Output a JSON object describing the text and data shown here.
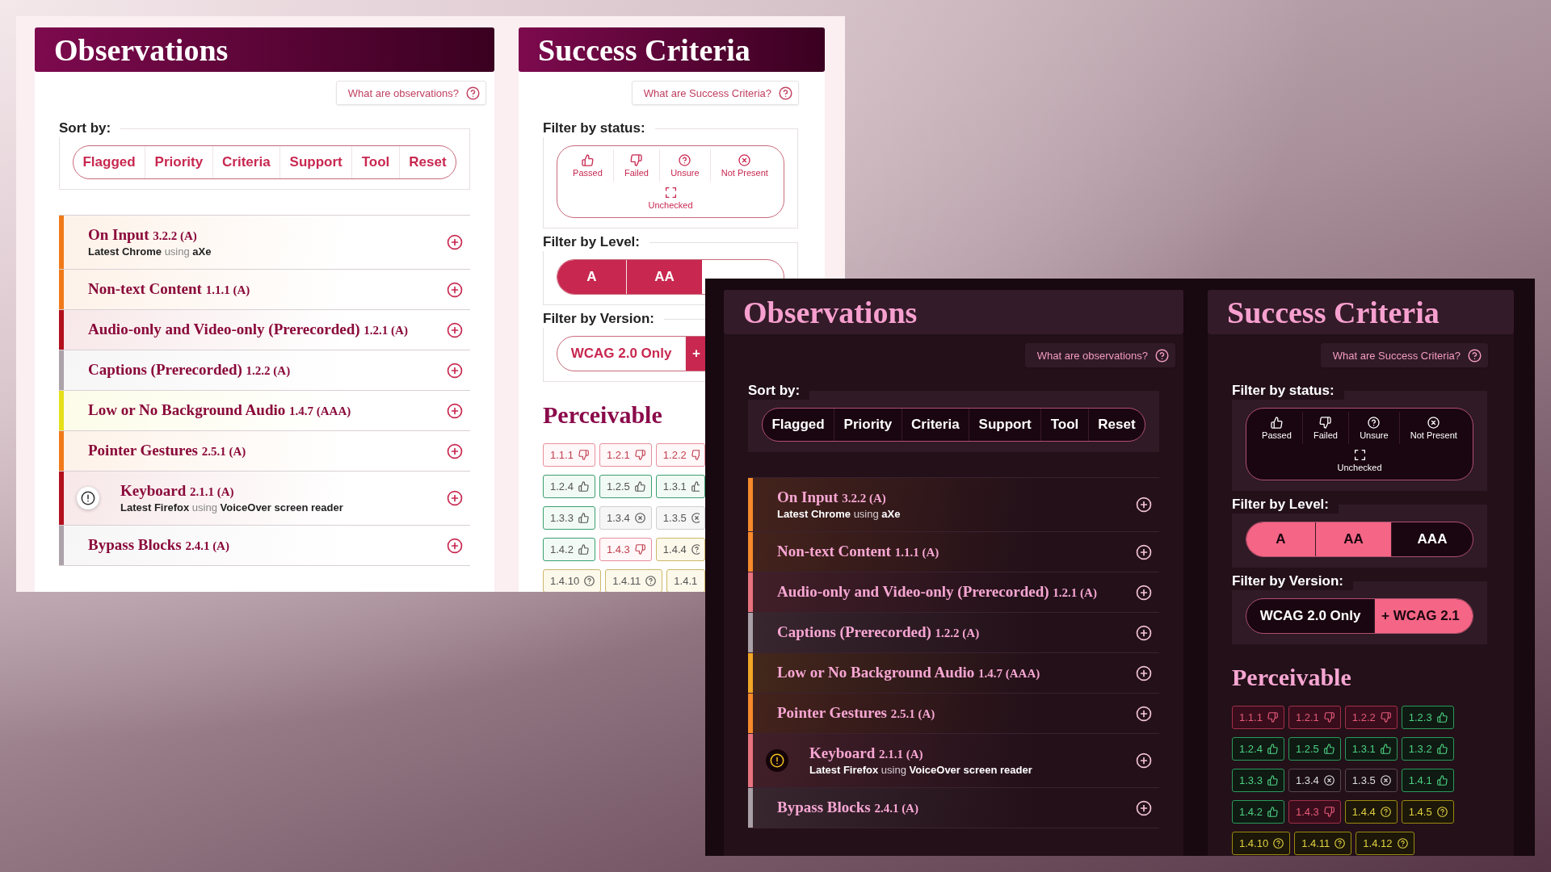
{
  "windows": [
    {
      "kind": "light",
      "observations": {
        "title": "Observations",
        "help": "What are observations?",
        "sort_label": "Sort by:",
        "sort_buttons": [
          "Flagged",
          "Priority",
          "Criteria",
          "Support",
          "Tool",
          "Reset"
        ],
        "items": [
          {
            "title": "On Input",
            "code": "3.2.2 (A)",
            "detail": "**Latest Chrome** using **aXe**",
            "color": "#f07a1a",
            "flagged": false
          },
          {
            "title": "Non-text Content",
            "code": "1.1.1 (A)",
            "color": "#f07a1a",
            "flagged": false
          },
          {
            "title": "Audio-only and Video-only (Prerecorded)",
            "code": "1.2.1 (A)",
            "color": "#b3101e",
            "flagged": false
          },
          {
            "title": "Captions (Prerecorded)",
            "code": "1.2.2 (A)",
            "color": "#aca2aa",
            "flagged": false
          },
          {
            "title": "Low or No Background Audio",
            "code": "1.4.7 (AAA)",
            "color": "#e5e01a",
            "flagged": false
          },
          {
            "title": "Pointer Gestures",
            "code": "2.5.1 (A)",
            "color": "#f07a1a",
            "flagged": false
          },
          {
            "title": "Keyboard",
            "code": "2.1.1 (A)",
            "detail": "**Latest Firefox** using **VoiceOver screen reader**",
            "color": "#b3101e",
            "flagged": true
          },
          {
            "title": "Bypass Blocks",
            "code": "2.4.1 (A)",
            "color": "#aca2aa",
            "flagged": false
          }
        ]
      },
      "criteria": {
        "title": "Success Criteria",
        "help": "What are Success Criteria?",
        "status_label": "Filter by status:",
        "statuses": [
          {
            "label": "Passed",
            "kind": "passed",
            "selected": false
          },
          {
            "label": "Failed",
            "kind": "failed",
            "selected": false
          },
          {
            "label": "Unsure",
            "kind": "unsure",
            "selected": false
          },
          {
            "label": "Not Present",
            "kind": "not-present",
            "selected": false
          },
          {
            "label": "Unchecked",
            "kind": "unchecked",
            "selected": false
          }
        ],
        "level_label": "Filter by Level:",
        "levels": [
          {
            "label": "A",
            "selected": true
          },
          {
            "label": "AA",
            "selected": true
          }
        ],
        "version_label": "Filter by Version:",
        "versions": [
          {
            "label": "WCAG 2.0 Only",
            "selected": false
          },
          {
            "label": "+",
            "selected": true
          }
        ],
        "section_title": "Perceivable",
        "criteria_rows": [
          [
            {
              "code": "1.1.1",
              "kind": "failed"
            },
            {
              "code": "1.2.1",
              "kind": "failed"
            },
            {
              "code": "1.2.2",
              "kind": "failed"
            }
          ],
          [
            {
              "code": "1.2.4",
              "kind": "passed"
            },
            {
              "code": "1.2.5",
              "kind": "passed"
            },
            {
              "code": "1.3.1",
              "kind": "passed"
            }
          ],
          [
            {
              "code": "1.3.3",
              "kind": "passed"
            },
            {
              "code": "1.3.4",
              "kind": "not-present"
            },
            {
              "code": "1.3.5",
              "kind": "not-present"
            }
          ],
          [
            {
              "code": "1.4.2",
              "kind": "passed"
            },
            {
              "code": "1.4.3",
              "kind": "failed"
            },
            {
              "code": "1.4.4",
              "kind": "unsure"
            }
          ],
          [
            {
              "code": "1.4.10",
              "kind": "unsure"
            },
            {
              "code": "1.4.11",
              "kind": "unsure"
            },
            {
              "code": "1.4.1",
              "kind": "unsure"
            }
          ]
        ]
      }
    },
    {
      "kind": "dark",
      "observations": {
        "title": "Observations",
        "help": "What are observations?",
        "sort_label": "Sort by:",
        "sort_buttons": [
          "Flagged",
          "Priority",
          "Criteria",
          "Support",
          "Tool",
          "Reset"
        ],
        "items": [
          {
            "title": "On Input",
            "code": "3.2.2 (A)",
            "detail": "**Latest Chrome** using **aXe**",
            "color": "#f7892b",
            "flagged": false
          },
          {
            "title": "Non-text Content",
            "code": "1.1.1 (A)",
            "color": "#f7892b",
            "flagged": false
          },
          {
            "title": "Audio-only and Video-only (Prerecorded)",
            "code": "1.2.1 (A)",
            "color": "#e8727f",
            "flagged": false
          },
          {
            "title": "Captions (Prerecorded)",
            "code": "1.2.2 (A)",
            "color": "#a8a0a6",
            "flagged": false
          },
          {
            "title": "Low or No Background Audio",
            "code": "1.4.7 (AAA)",
            "color": "#f0a626",
            "flagged": false
          },
          {
            "title": "Pointer Gestures",
            "code": "2.5.1 (A)",
            "color": "#f7892b",
            "flagged": false
          },
          {
            "title": "Keyboard",
            "code": "2.1.1 (A)",
            "detail": "**Latest Firefox** using **VoiceOver screen reader**",
            "color": "#e8727f",
            "flagged": true
          },
          {
            "title": "Bypass Blocks",
            "code": "2.4.1 (A)",
            "color": "#a8a0a6",
            "flagged": false
          }
        ]
      },
      "criteria": {
        "title": "Success Criteria",
        "help": "What are Success Criteria?",
        "status_label": "Filter by status:",
        "statuses": [
          {
            "label": "Passed",
            "kind": "passed",
            "selected": false
          },
          {
            "label": "Failed",
            "kind": "failed",
            "selected": false
          },
          {
            "label": "Unsure",
            "kind": "unsure",
            "selected": false
          },
          {
            "label": "Not Present",
            "kind": "not-present",
            "selected": false
          },
          {
            "label": "Unchecked",
            "kind": "unchecked",
            "selected": false
          }
        ],
        "level_label": "Filter by Level:",
        "levels": [
          {
            "label": "A",
            "selected": true
          },
          {
            "label": "AA",
            "selected": true
          },
          {
            "label": "AAA",
            "selected": false
          }
        ],
        "version_label": "Filter by Version:",
        "versions": [
          {
            "label": "WCAG 2.0 Only",
            "selected": false
          },
          {
            "label": "+ WCAG 2.1",
            "selected": true
          }
        ],
        "section_title": "Perceivable",
        "criteria_rows": [
          [
            {
              "code": "1.1.1",
              "kind": "failed"
            },
            {
              "code": "1.2.1",
              "kind": "failed"
            },
            {
              "code": "1.2.2",
              "kind": "failed"
            },
            {
              "code": "1.2.3",
              "kind": "passed"
            }
          ],
          [
            {
              "code": "1.2.4",
              "kind": "passed"
            },
            {
              "code": "1.2.5",
              "kind": "passed"
            },
            {
              "code": "1.3.1",
              "kind": "passed"
            },
            {
              "code": "1.3.2",
              "kind": "passed"
            }
          ],
          [
            {
              "code": "1.3.3",
              "kind": "passed"
            },
            {
              "code": "1.3.4",
              "kind": "not-present"
            },
            {
              "code": "1.3.5",
              "kind": "not-present"
            },
            {
              "code": "1.4.1",
              "kind": "passed"
            }
          ],
          [
            {
              "code": "1.4.2",
              "kind": "passed"
            },
            {
              "code": "1.4.3",
              "kind": "failed"
            },
            {
              "code": "1.4.4",
              "kind": "unsure"
            },
            {
              "code": "1.4.5",
              "kind": "unsure"
            }
          ],
          [
            {
              "code": "1.4.10",
              "kind": "unsure"
            },
            {
              "code": "1.4.11",
              "kind": "unsure"
            },
            {
              "code": "1.4.12",
              "kind": "unsure"
            }
          ]
        ]
      }
    }
  ]
}
